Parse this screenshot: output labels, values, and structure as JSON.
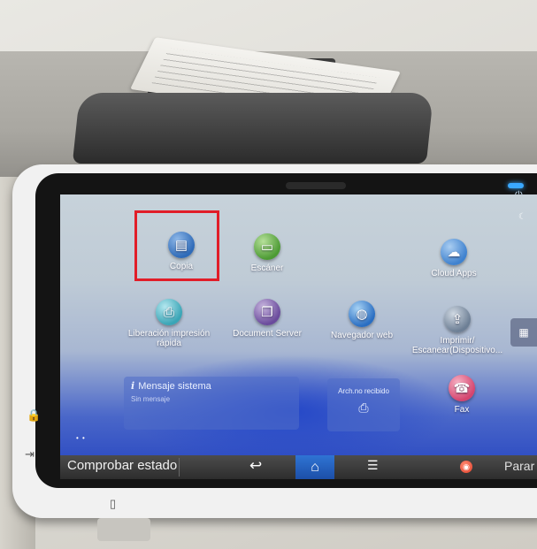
{
  "home_screen": {
    "apps": [
      {
        "id": "copia",
        "label": "Copia",
        "icon": "copy-icon"
      },
      {
        "id": "escaner",
        "label": "Escáner",
        "icon": "scanner-icon"
      },
      {
        "id": "cloud",
        "label": "Cloud Apps",
        "icon": "cloud-icon"
      },
      {
        "id": "liberacion",
        "label": "Liberación impresión rápida",
        "icon": "print-release-icon"
      },
      {
        "id": "docserver",
        "label": "Document Server",
        "icon": "document-server-icon"
      },
      {
        "id": "navegador",
        "label": "Navegador web",
        "icon": "globe-icon"
      },
      {
        "id": "imprimir",
        "label": "Imprimir/ Escanear(Dispositivo...",
        "icon": "usb-icon"
      },
      {
        "id": "fax",
        "label": "Fax",
        "icon": "fax-icon"
      }
    ],
    "message_widget": {
      "title": "Mensaje sistema",
      "subtitle": "Sin mensaje"
    },
    "fax_widget": {
      "label": "Arch.no recibido"
    },
    "highlight_color": "#e11d28"
  },
  "bottom_bar": {
    "status_label": "Comprobar estado",
    "stop_label": "Parar",
    "home_color": "#2f74d4"
  }
}
